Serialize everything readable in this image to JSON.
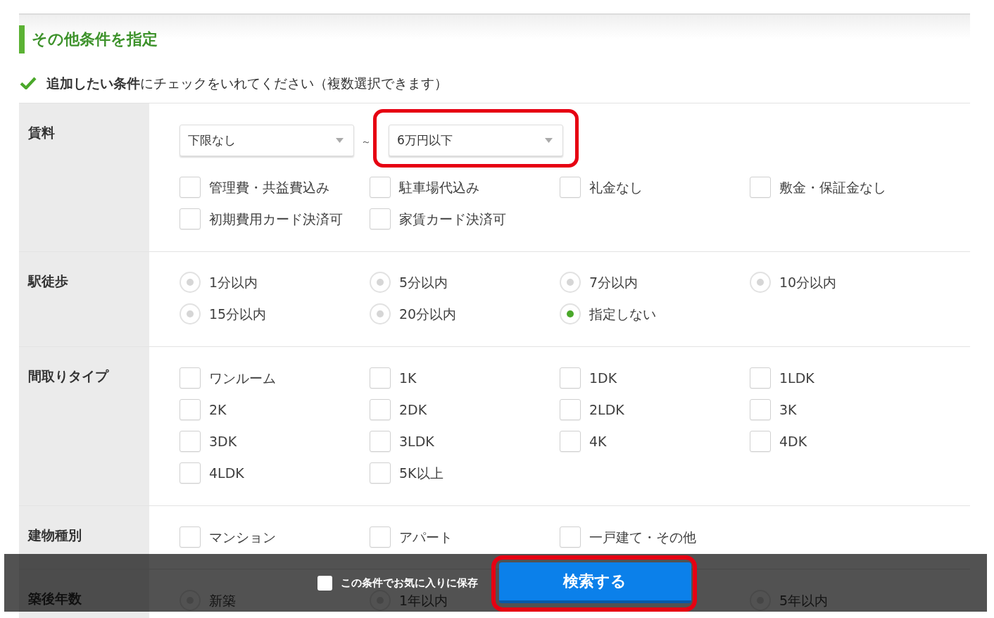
{
  "section": {
    "title": "その他条件を指定",
    "instruction": "**追加したい条件**にチェックをいれてください（複数選択できます）"
  },
  "conditions": [
    {
      "label": "賃料",
      "kind": "checkbox",
      "range": {
        "min": {
          "value": "下限なし",
          "highlighted": false
        },
        "separator": "～",
        "max": {
          "value": "6万円以下",
          "highlighted": true
        }
      },
      "options": [
        {
          "label": "管理費・共益費込み",
          "checked": false
        },
        {
          "label": "駐車場代込み",
          "checked": false
        },
        {
          "label": "礼金なし",
          "checked": false
        },
        {
          "label": "敷金・保証金なし",
          "checked": false
        },
        {
          "label": "初期費用カード決済可",
          "checked": false
        },
        {
          "label": "家賃カード決済可",
          "checked": false
        }
      ]
    },
    {
      "label": "駅徒歩",
      "kind": "radio",
      "options": [
        {
          "label": "1分以内",
          "selected": false
        },
        {
          "label": "5分以内",
          "selected": false
        },
        {
          "label": "7分以内",
          "selected": false
        },
        {
          "label": "10分以内",
          "selected": false
        },
        {
          "label": "15分以内",
          "selected": false
        },
        {
          "label": "20分以内",
          "selected": false
        },
        {
          "label": "指定しない",
          "selected": true
        }
      ]
    },
    {
      "label": "間取りタイプ",
      "kind": "checkbox",
      "options": [
        {
          "label": "ワンルーム",
          "checked": false
        },
        {
          "label": "1K",
          "checked": false
        },
        {
          "label": "1DK",
          "checked": false
        },
        {
          "label": "1LDK",
          "checked": false
        },
        {
          "label": "2K",
          "checked": false
        },
        {
          "label": "2DK",
          "checked": false
        },
        {
          "label": "2LDK",
          "checked": false
        },
        {
          "label": "3K",
          "checked": false
        },
        {
          "label": "3DK",
          "checked": false
        },
        {
          "label": "3LDK",
          "checked": false
        },
        {
          "label": "4K",
          "checked": false
        },
        {
          "label": "4DK",
          "checked": false
        },
        {
          "label": "4LDK",
          "checked": false
        },
        {
          "label": "5K以上",
          "checked": false
        }
      ]
    },
    {
      "label": "建物種別",
      "kind": "checkbox",
      "options": [
        {
          "label": "マンション",
          "checked": false
        },
        {
          "label": "アパート",
          "checked": false
        },
        {
          "label": "一戸建て・その他",
          "checked": false
        }
      ]
    }
  ],
  "row_under_bar": {
    "label": "築後年数",
    "kind": "radio",
    "options": [
      {
        "label": "新築",
        "selected": false
      },
      {
        "label": "1年以内",
        "selected": false
      },
      {
        "label": "5年以内",
        "selected": false
      }
    ]
  },
  "footer": {
    "save": {
      "label": "この条件でお気に入りに保存",
      "checked": false
    },
    "search_button": {
      "label": "検索する",
      "highlighted": true
    }
  }
}
